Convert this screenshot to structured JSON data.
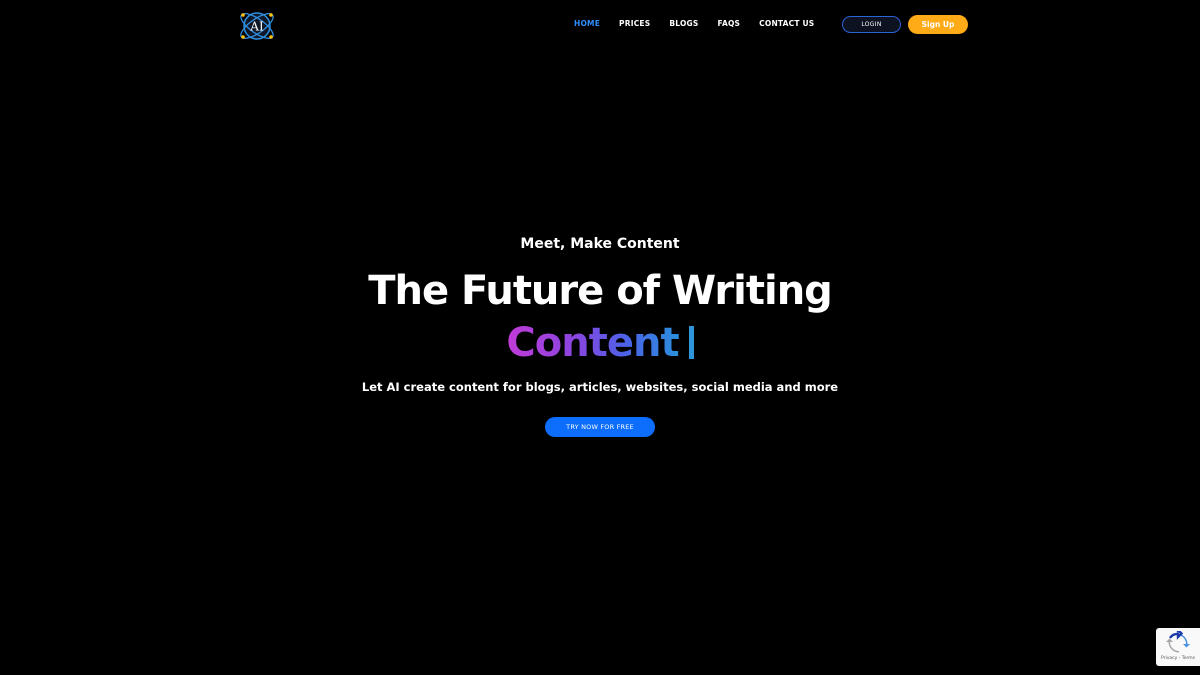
{
  "header": {
    "logo_text": "AI",
    "nav": [
      {
        "label": "HOME",
        "active": true
      },
      {
        "label": "PRICES",
        "active": false
      },
      {
        "label": "BLOGS",
        "active": false
      },
      {
        "label": "FAQS",
        "active": false
      },
      {
        "label": "CONTACT US",
        "active": false
      }
    ],
    "login_label": "LOGIN",
    "signup_label": "Sign Up"
  },
  "hero": {
    "eyebrow": "Meet, Make Content",
    "headline": "The Future of Writing",
    "typed_word": "Content",
    "subtitle": "Let AI create content for blogs, articles, websites, social media and more",
    "cta_label": "TRY NOW FOR FREE"
  },
  "recaptcha": {
    "terms_text": "Privacy - Terms"
  },
  "colors": {
    "background": "#000000",
    "accent": "#2e8fff",
    "signup": "#ffaa17",
    "cta": "#0d6efd"
  },
  "icons": {
    "logo": "atom-ai-logo-icon",
    "recaptcha": "recaptcha-icon"
  }
}
